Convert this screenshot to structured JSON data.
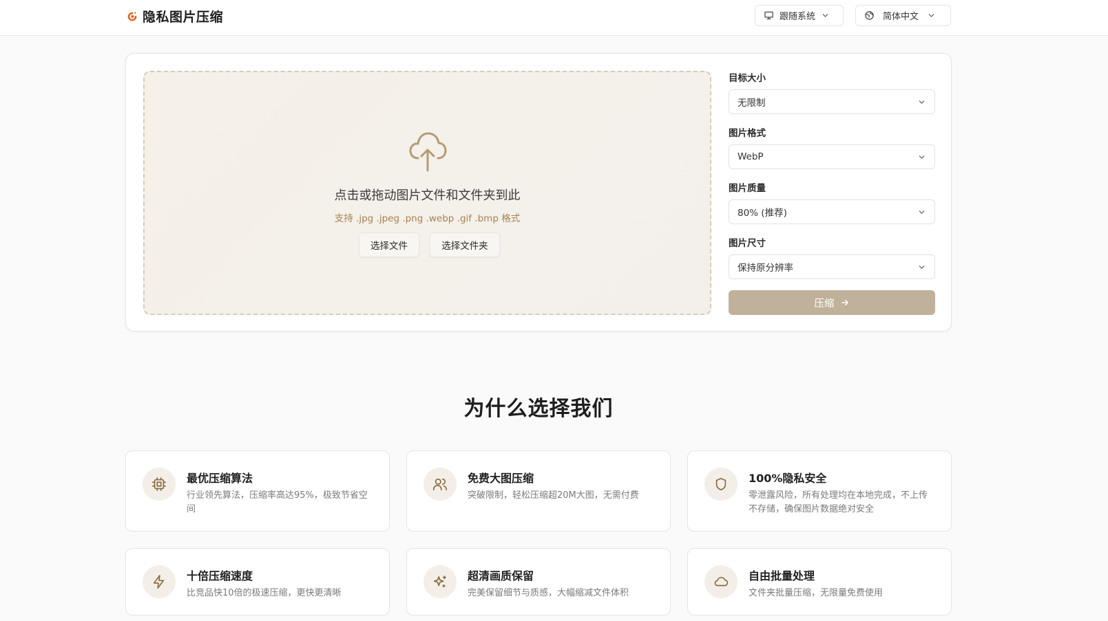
{
  "header": {
    "app_name": "隐私图片压缩",
    "theme_label": "跟随系统",
    "language_label": "简体中文"
  },
  "upload": {
    "title": "点击或拖动图片文件和文件夹到此",
    "formats": "支持 .jpg .jpeg .png .webp .gif .bmp 格式",
    "choose_file": "选择文件",
    "choose_folder": "选择文件夹"
  },
  "settings": {
    "target_size": {
      "label": "目标大小",
      "value": "无限制"
    },
    "format": {
      "label": "图片格式",
      "value": "WebP"
    },
    "quality": {
      "label": "图片质量",
      "value": "80% (推荐)"
    },
    "dimension": {
      "label": "图片尺寸",
      "value": "保持原分辨率"
    },
    "compress_label": "压缩"
  },
  "why": {
    "title": "为什么选择我们",
    "features": [
      {
        "icon": "cpu-icon",
        "title": "最优压缩算法",
        "desc": "行业领先算法，压缩率高达95%，极致节省空间"
      },
      {
        "icon": "users-icon",
        "title": "免费大图压缩",
        "desc": "突破限制，轻松压缩超20M大图，无需付费"
      },
      {
        "icon": "shield-icon",
        "title": "100%隐私安全",
        "desc": "零泄露风险，所有处理均在本地完成，不上传不存储，确保图片数据绝对安全"
      },
      {
        "icon": "lightning-icon",
        "title": "十倍压缩速度",
        "desc": "比竞品快10倍的极速压缩，更快更清晰"
      },
      {
        "icon": "sparkles-icon",
        "title": "超清画质保留",
        "desc": "完美保留细节与质感，大幅缩减文件体积"
      },
      {
        "icon": "cloud-icon",
        "title": "自由批量处理",
        "desc": "文件夹批量压缩，无限量免费使用"
      }
    ]
  },
  "colors": {
    "accent": "#c0b19a",
    "accent_text": "#a8834f",
    "logo": "#e0651f",
    "icon_bg": "#f3efe8"
  }
}
